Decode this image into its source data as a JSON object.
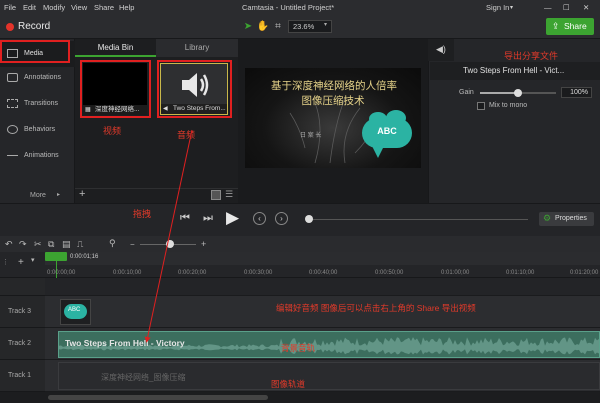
{
  "menu": {
    "items": [
      "File",
      "Edit",
      "Modify",
      "View",
      "Share",
      "Help"
    ],
    "window_title": "Camtasia - Untitled Project*",
    "sign_in": "Sign In"
  },
  "toolbar": {
    "record_label": "Record",
    "zoom": "23.6%",
    "share_label": "Share"
  },
  "tools_panel": {
    "items": [
      "Media",
      "Annotations",
      "Transitions",
      "Behaviors",
      "Animations"
    ],
    "more_label": "More"
  },
  "media_bin": {
    "tabs": [
      "Media Bin",
      "Library"
    ],
    "thumbs": [
      {
        "label": "深度神经网络..."
      },
      {
        "label": "Two Steps From..."
      }
    ]
  },
  "canvas": {
    "title_line1": "基于深度神经网络的人倍率",
    "title_line2": "图像压缩技术",
    "small_text": "日 案 长",
    "bubble_text": "ABC"
  },
  "properties": {
    "clip_title": "Two Steps From Hell - Vict...",
    "gain_label": "Gain",
    "gain_value": "100%",
    "gain_level": 1.0,
    "mix_label": "Mix to mono",
    "properties_button": "Properties"
  },
  "timeline": {
    "playhead_time": "0:00:01;16",
    "ticks": [
      "0:00:00;00",
      "0:00:10;00",
      "0:00:20;00",
      "0:00:30;00",
      "0:00:40;00",
      "0:00:50;00",
      "0:01:00;00",
      "0:01:10;00",
      "0:01:20;00"
    ],
    "tracks": [
      {
        "name": "Track 3"
      },
      {
        "name": "Track 2"
      },
      {
        "name": "Track 1"
      }
    ],
    "track3_clip_text": "ABC",
    "audio_clip_title": "Two Steps From Hell - Victory",
    "video_clip_title": "深度神经网络_图像压缩"
  },
  "annotations": {
    "share_note": "导出分享文件",
    "video_note": "视频",
    "audio_note": "音频",
    "drag_note": "拖拽",
    "edit_note": "编辑好音频 图像后可以点击右上角的 Share 导出视频",
    "audio_track_note": "背景音轨",
    "video_track_note": "图像轨道"
  },
  "colors": {
    "accent_green": "#3ca431",
    "annotation_red": "#e02020",
    "audio_clip": "#3c6e5e",
    "bubble": "#2bb3a3"
  }
}
